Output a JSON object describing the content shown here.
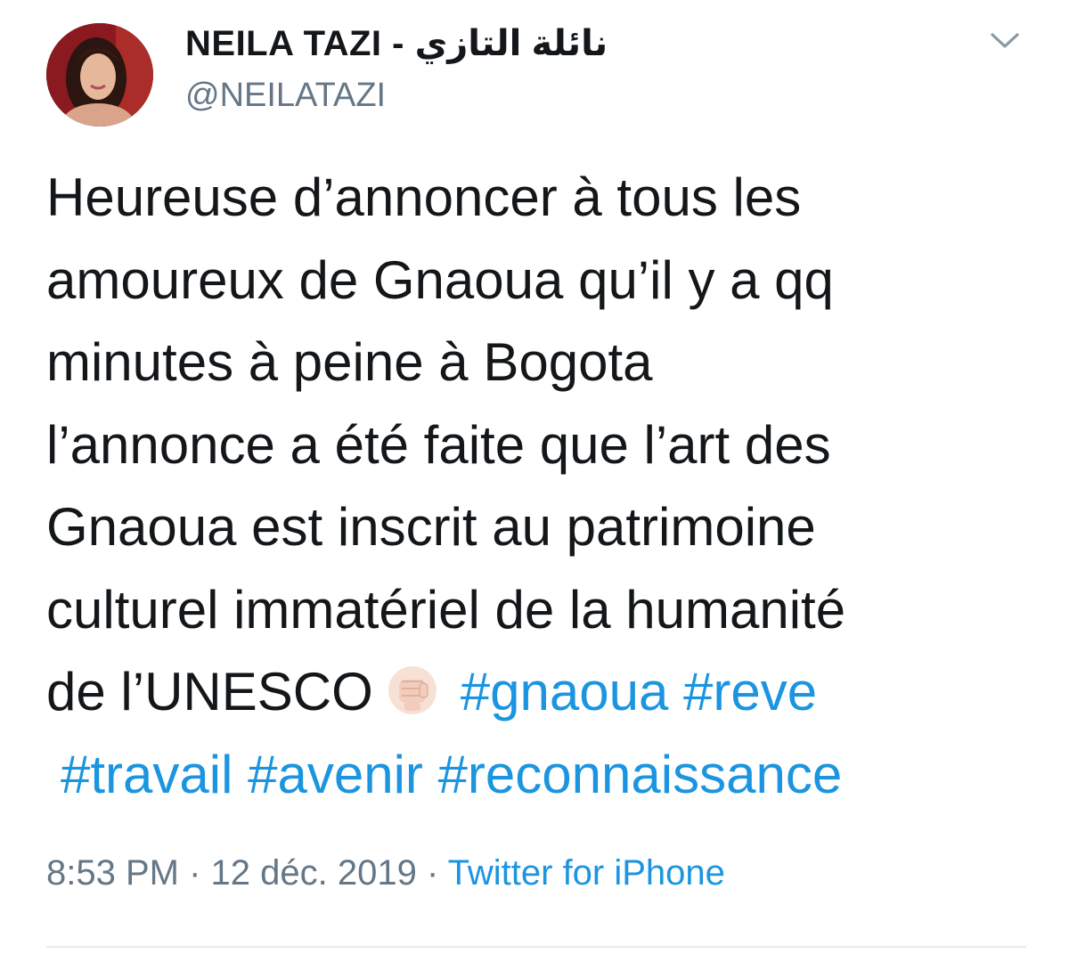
{
  "author": {
    "display_name": "NEILA TAZI - نائلة التازي",
    "handle": "@NEILATAZI",
    "avatar_icon": "profile-photo"
  },
  "tweet": {
    "lines": [
      "Heureuse d’annoncer à tous les",
      "amoureux de Gnaoua qu’il y a qq",
      "minutes à peine à Bogota",
      "l’annonce a été faite que l’art des",
      "Gnaoua est inscrit au patrimoine",
      "culturel immatériel de la humanité",
      "de l’UNESCO"
    ],
    "emoji_icon": "raised-fist-light-skin-tone",
    "hashtags_line7": [
      "#gnaoua",
      "#reve"
    ],
    "hashtags_line8": [
      "#travail",
      "#avenir",
      "#reconnaissance"
    ]
  },
  "meta": {
    "time": "8:53 PM",
    "separator1": " · ",
    "date": "12 déc. 2019",
    "separator2": " · ",
    "source": "Twitter for iPhone"
  },
  "colors": {
    "link": "#1b95e0",
    "secondary_text": "#657786",
    "primary_text": "#14171a"
  },
  "icons": {
    "menu": "chevron-down-icon"
  }
}
